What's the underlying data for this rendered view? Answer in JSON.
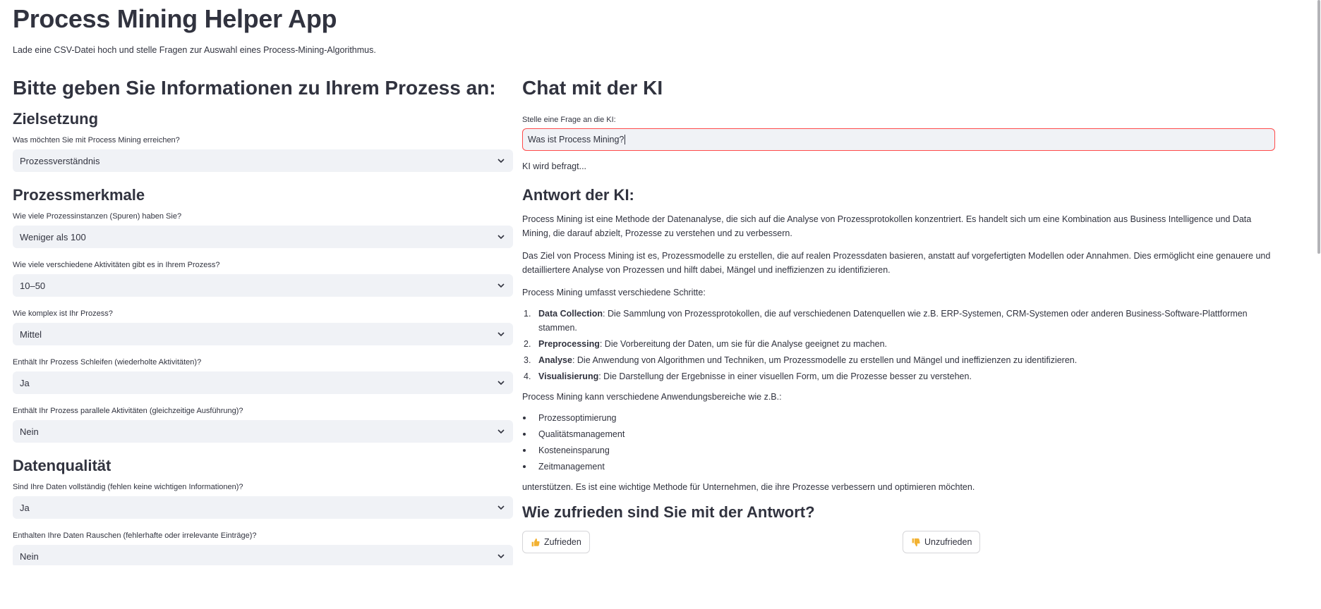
{
  "app": {
    "title": "Process Mining Helper App",
    "subtitle": "Lade eine CSV-Datei hoch und stelle Fragen zur Auswahl eines Process-Mining-Algorithmus."
  },
  "form": {
    "heading": "Bitte geben Sie Informationen zu Ihrem Prozess an:",
    "sections": [
      {
        "title": "Zielsetzung",
        "fields": [
          {
            "label": "Was möchten Sie mit Process Mining erreichen?",
            "value": "Prozessverständnis"
          }
        ]
      },
      {
        "title": "Prozessmerkmale",
        "fields": [
          {
            "label": "Wie viele Prozessinstanzen (Spuren) haben Sie?",
            "value": "Weniger als 100"
          },
          {
            "label": "Wie viele verschiedene Aktivitäten gibt es in Ihrem Prozess?",
            "value": "10–50"
          },
          {
            "label": "Wie komplex ist Ihr Prozess?",
            "value": "Mittel"
          },
          {
            "label": "Enthält Ihr Prozess Schleifen (wiederholte Aktivitäten)?",
            "value": "Ja"
          },
          {
            "label": "Enthält Ihr Prozess parallele Aktivitäten (gleichzeitige Ausführung)?",
            "value": "Nein"
          }
        ]
      },
      {
        "title": "Datenqualität",
        "fields": [
          {
            "label": "Sind Ihre Daten vollständig (fehlen keine wichtigen Informationen)?",
            "value": "Ja"
          },
          {
            "label": "Enthalten Ihre Daten Rauschen (fehlerhafte oder irrelevante Einträge)?",
            "value": "Nein"
          }
        ]
      }
    ]
  },
  "chat": {
    "heading": "Chat mit der KI",
    "input_label": "Stelle eine Frage an die KI:",
    "input_value": "Was ist Process Mining?",
    "status": "KI wird befragt...",
    "answer_heading": "Antwort der KI:",
    "paragraphs": [
      "Process Mining ist eine Methode der Datenanalyse, die sich auf die Analyse von Prozessprotokollen konzentriert. Es handelt sich um eine Kombination aus Business Intelligence und Data Mining, die darauf abzielt, Prozesse zu verstehen und zu verbessern.",
      "Das Ziel von Process Mining ist es, Prozessmodelle zu erstellen, die auf realen Prozessdaten basieren, anstatt auf vorgefertigten Modellen oder Annahmen. Dies ermöglicht eine genauere und detailliertere Analyse von Prozessen und hilft dabei, Mängel und ineffizienzen zu identifizieren.",
      "Process Mining umfasst verschiedene Schritte:"
    ],
    "steps": [
      {
        "num": "1.",
        "term": "Data Collection",
        "text": ": Die Sammlung von Prozessprotokollen, die auf verschiedenen Datenquellen wie z.B. ERP-Systemen, CRM-Systemen oder anderen Business-Software-Plattformen stammen."
      },
      {
        "num": "2.",
        "term": "Preprocessing",
        "text": ": Die Vorbereitung der Daten, um sie für die Analyse geeignet zu machen."
      },
      {
        "num": "3.",
        "term": "Analyse",
        "text": ": Die Anwendung von Algorithmen und Techniken, um Prozessmodelle zu erstellen und Mängel und ineffizienzen zu identifizieren."
      },
      {
        "num": "4.",
        "term": "Visualisierung",
        "text": ": Die Darstellung der Ergebnisse in einer visuellen Form, um die Prozesse besser zu verstehen."
      }
    ],
    "areas_intro": "Process Mining kann verschiedene Anwendungsbereiche wie z.B.:",
    "areas": [
      "Prozessoptimierung",
      "Qualitätsmanagement",
      "Kosteneinsparung",
      "Zeitmanagement"
    ],
    "closing": "unterstützen. Es ist eine wichtige Methode für Unternehmen, die ihre Prozesse verbessern und optimieren möchten.",
    "feedback_heading": "Wie zufrieden sind Sie mit der Antwort?",
    "btn_satisfied": "Zufrieden",
    "btn_unsatisfied": "Unzufrieden"
  },
  "colors": {
    "text": "#31333f",
    "input_bg": "#f0f2f6",
    "focus_border": "#ff4b4b",
    "thumb": "#f2b233"
  },
  "icons": {
    "select_chevron": "chevron-down-icon",
    "thumbs_up": "thumbs-up-icon",
    "thumbs_down": "thumbs-down-icon"
  }
}
